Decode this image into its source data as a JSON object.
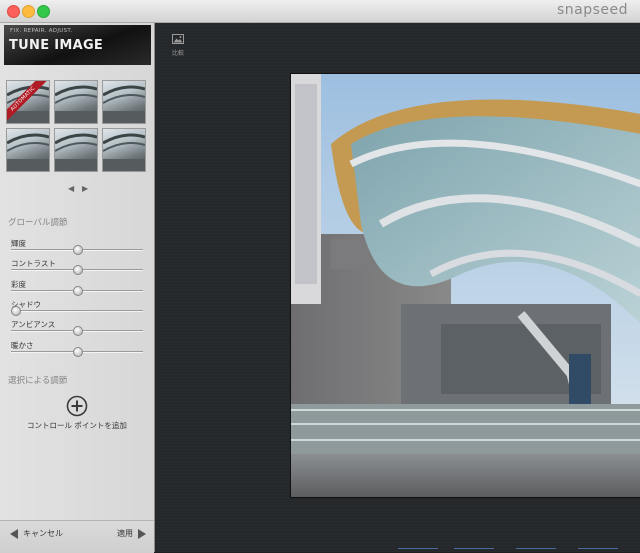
{
  "window": {
    "brand": "snapseed"
  },
  "tool": {
    "tagline": "FIX. REPAIR. ADJUST.",
    "title": "TUNE IMAGE"
  },
  "presets": {
    "auto_badge": "AUTOMATIC",
    "count": 6
  },
  "global": {
    "title": "グローバル調節",
    "adjustments": [
      {
        "label": "輝度",
        "value": 0.5
      },
      {
        "label": "コントラスト",
        "value": 0.5
      },
      {
        "label": "彩度",
        "value": 0.5
      },
      {
        "label": "シャドウ",
        "value": 0.0
      },
      {
        "label": "アンビアンス",
        "value": 0.5
      },
      {
        "label": "暖かさ",
        "value": 0.5
      }
    ]
  },
  "selective": {
    "title": "選択による調節",
    "add_label": "コントロール ポイントを追加"
  },
  "footer": {
    "cancel": "キャンセル",
    "apply": "適用"
  },
  "canvas": {
    "compare_label": "比較"
  },
  "colors": {
    "accent_red": "#b11c24",
    "canopy_gold": "#c49a52",
    "sky": "#a9c6e0"
  }
}
